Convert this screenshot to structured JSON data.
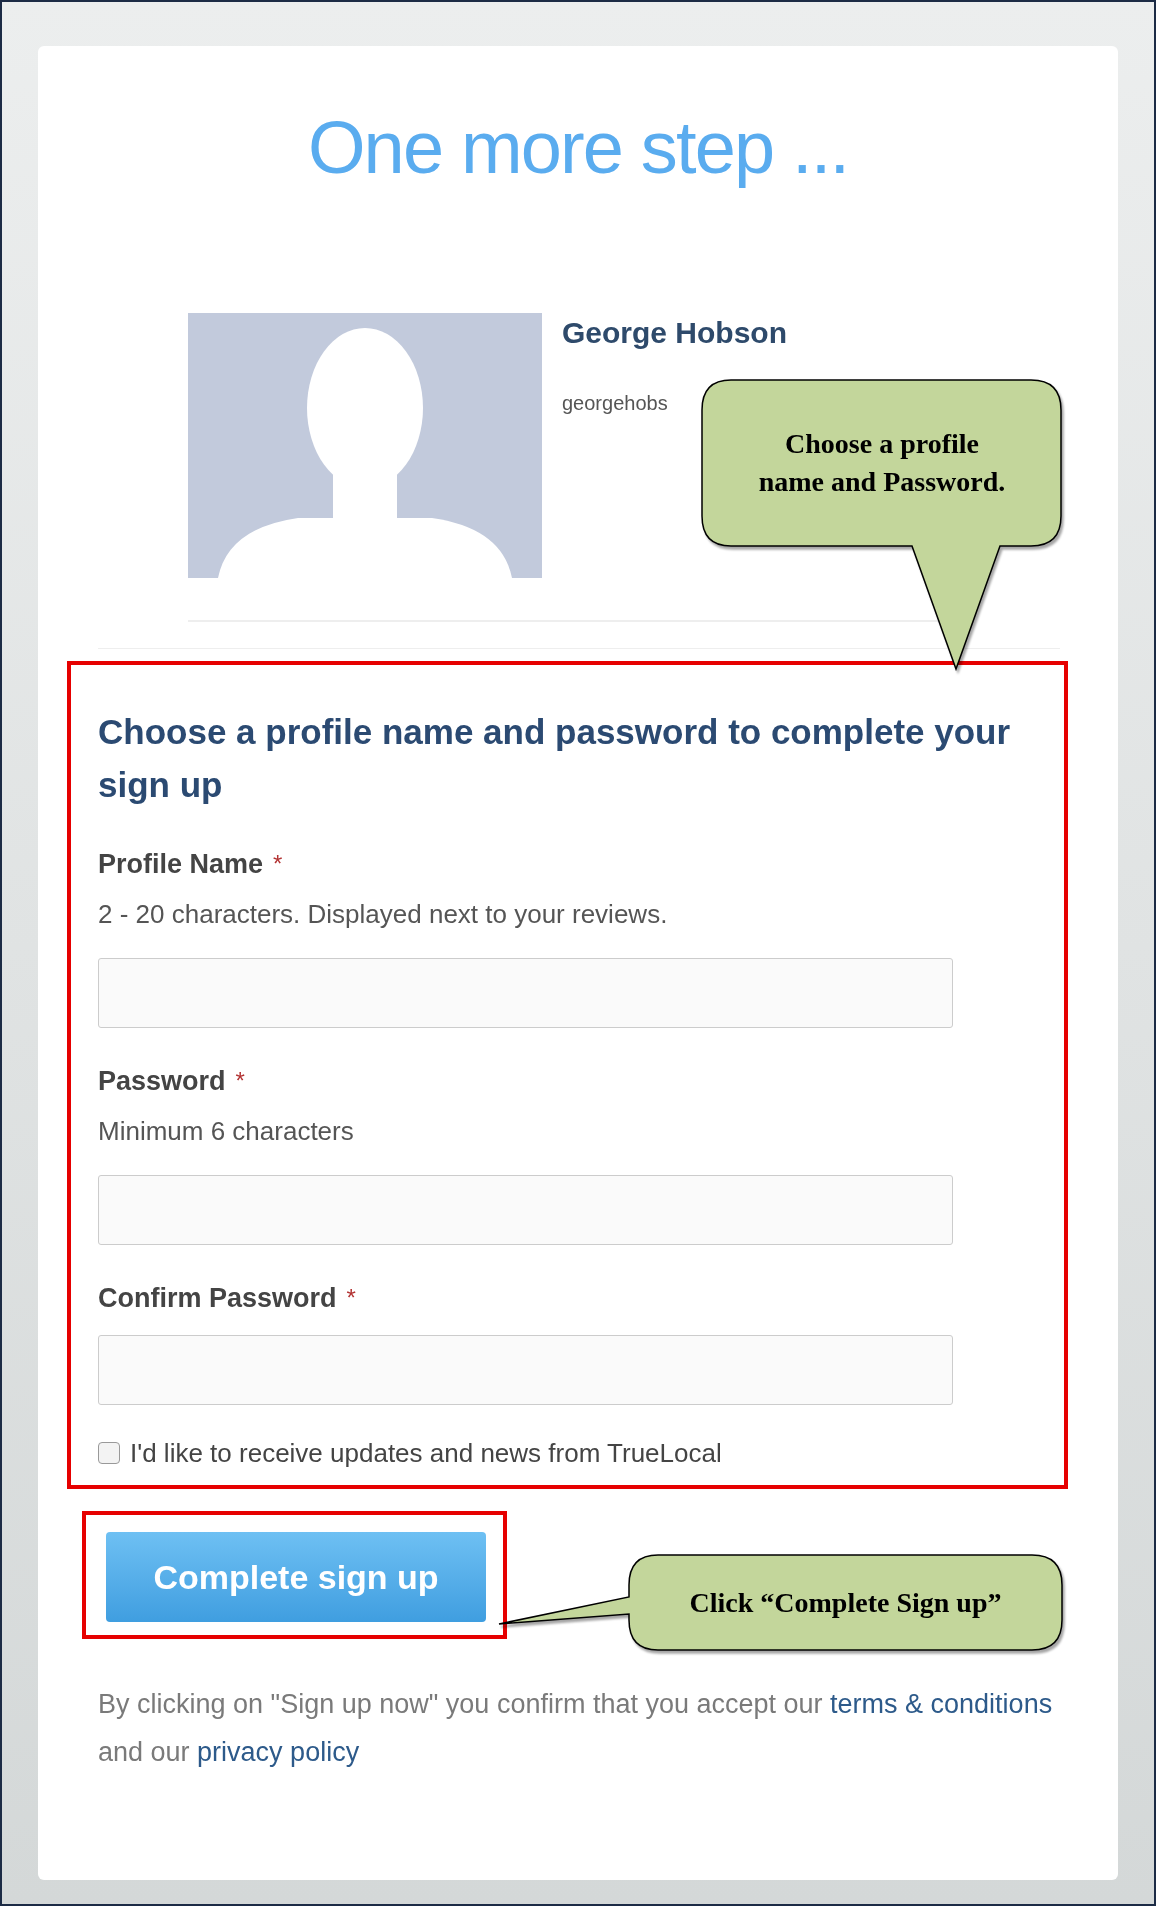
{
  "title": "One more step ...",
  "profile": {
    "name": "George Hobson",
    "email": "georgehobs"
  },
  "form": {
    "heading": "Choose a profile name and password to complete your sign up",
    "fields": [
      {
        "label": "Profile Name",
        "mark": "*",
        "hint": "2 - 20 characters. Displayed next to your reviews."
      },
      {
        "label": "Password",
        "mark": "*",
        "hint": "Minimum 6 characters"
      },
      {
        "label": "Confirm Password",
        "mark": "*"
      }
    ],
    "newsletter": {
      "label": "I'd like to receive updates and news from TrueLocal",
      "checked": false
    },
    "submit": "Complete sign up",
    "legal": {
      "text_before": "By clicking on \"Sign up now\" you confirm that you accept our",
      "link_1": "terms & conditions",
      "text_middle": "and our",
      "link_2": "privacy policy"
    }
  },
  "callouts": [
    {
      "text": "Choose a profile name and Password."
    },
    {
      "text": "Click “Complete Sign up”"
    }
  ]
}
